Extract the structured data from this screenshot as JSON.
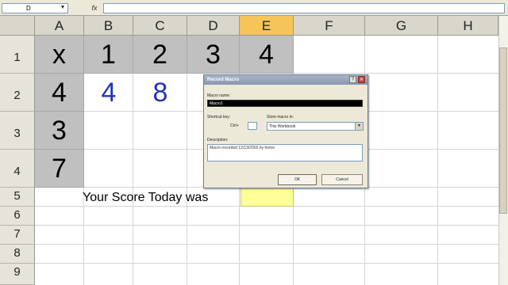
{
  "formula_bar": {
    "name_box": "D",
    "name_box_arrow": "▼",
    "fx": "fx"
  },
  "columns": [
    "A",
    "B",
    "C",
    "D",
    "E",
    "F",
    "G",
    "H"
  ],
  "rows": [
    "1",
    "2",
    "3",
    "4",
    "5",
    "6",
    "7",
    "8",
    "9"
  ],
  "sheet": {
    "x_symbol": "x",
    "col_factors": [
      "1",
      "2",
      "3",
      "4"
    ],
    "row_factors": [
      "4",
      "3",
      "7"
    ],
    "answers": [
      "4",
      "8"
    ],
    "score_label": "Your Score Today was"
  },
  "dialog": {
    "title": "Record Macro",
    "help": "?",
    "close": "✕",
    "macro_name_label": "Macro name:",
    "macro_name_value": "Macro1",
    "shortcut_label": "Shortcut key:",
    "ctrl_label": "Ctrl+",
    "store_label": "Store macro in:",
    "store_value": "This Workbook",
    "store_arrow": "▼",
    "description_label": "Description:",
    "description_value": "Macro recorded 12/13/2003 by home",
    "ok": "OK",
    "cancel": "Cancel"
  },
  "colors": {
    "shaded_cell": "#c0c0c0",
    "answer_text": "#2233bb",
    "score_cell": "#ffff99",
    "selected_column_header": "#f6c55a"
  }
}
